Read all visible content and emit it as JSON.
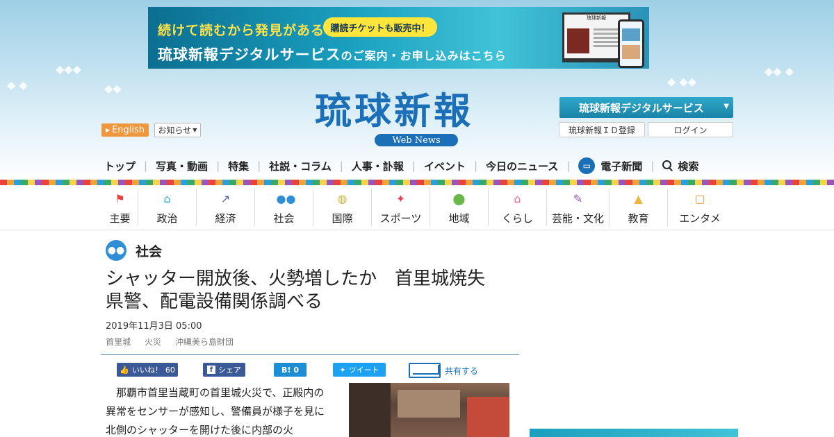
{
  "banner": {
    "line1": "続けて読むから発見がある",
    "pill": "購読チケットも販売中！",
    "line2_a": "琉球新報デジタルサービス",
    "line2_b": "のご案内・お申し込み",
    "line2_c": "はこちら",
    "laptop_title": "琉球新報"
  },
  "header": {
    "english_label": "English",
    "notice_label": "お知らせ",
    "logo": "琉球新報",
    "logo_sub": "Web News",
    "digital_service_label": "琉球新報デジタルサービス",
    "register_label": "琉球新報ＩＤ登録",
    "login_label": "ログイン"
  },
  "mainnav": {
    "items": [
      "トップ",
      "写真・動画",
      "特集",
      "社説・コラム",
      "人事・訃報",
      "イベント",
      "今日のニュース"
    ],
    "epaper_label": "電子新聞",
    "search_label": "検索"
  },
  "categories": [
    {
      "label": "主要",
      "icon": "flag-icon",
      "color": "#e8423b"
    },
    {
      "label": "政治",
      "icon": "building-icon",
      "color": "#3aa6c9"
    },
    {
      "label": "経済",
      "icon": "chart-icon",
      "color": "#4a5fa8"
    },
    {
      "label": "社会",
      "icon": "people-icon",
      "color": "#2f8fd6"
    },
    {
      "label": "国際",
      "icon": "globe-icon",
      "color": "#c9b63a"
    },
    {
      "label": "スポーツ",
      "icon": "runner-icon",
      "color": "#e8425a"
    },
    {
      "label": "地域",
      "icon": "pin-icon",
      "color": "#6ab84a"
    },
    {
      "label": "くらし",
      "icon": "house-icon",
      "color": "#e86a9a"
    },
    {
      "label": "芸能・文化",
      "icon": "brush-icon",
      "color": "#9a55b8"
    },
    {
      "label": "教育",
      "icon": "graduation-icon",
      "color": "#e8b83a"
    },
    {
      "label": "エンタメ",
      "icon": "tv-icon",
      "color": "#f0963c"
    }
  ],
  "article": {
    "section": "社会",
    "headline": "シャッター開放後、火勢増したか　首里城焼失　県警、配電設備関係調べる",
    "date": "2019年11月3日 05:00",
    "tags": [
      "首里城",
      "火災",
      "沖縄美ら島財団"
    ],
    "body": "　那覇市首里当蔵町の首里城火災で、正殿内の異常をセンサーが感知し、警備員が様子を見に北側のシャッターを開けた後に内部の火"
  },
  "share": {
    "like_label": "いいね！",
    "like_count": "60",
    "fb_label": "シェア",
    "hatena_label": "B!",
    "hatena_count": "0",
    "tweet_label": "ツイート",
    "mail_label": "共有する"
  }
}
